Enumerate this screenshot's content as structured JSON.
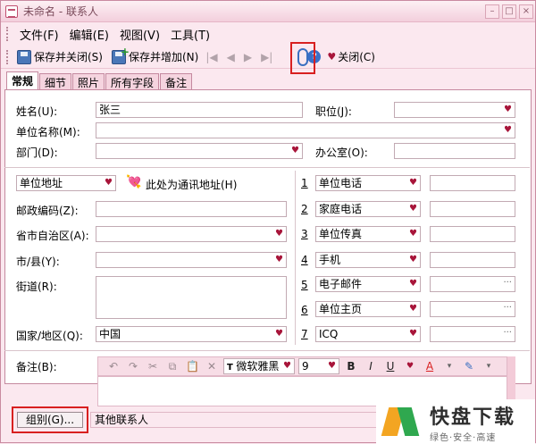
{
  "title": "未命名 - 联系人",
  "menu": [
    "文件(F)",
    "编辑(E)",
    "视图(V)",
    "工具(T)"
  ],
  "toolbar": {
    "save_close": "保存并关闭(S)",
    "save_add": "保存并增加(N)",
    "close": "关闭(C)"
  },
  "tabs": [
    "常规",
    "细节",
    "照片",
    "所有字段",
    "备注"
  ],
  "form": {
    "name_label": "姓名(U):",
    "name_value": "张三",
    "position_label": "职位(J):",
    "company_label": "单位名称(M):",
    "dept_label": "部门(D):",
    "office_label": "办公室(O):",
    "address_type": "单位地址",
    "mailing_label": "此处为通讯地址(H)",
    "postal_label": "邮政编码(Z):",
    "province_label": "省市自治区(A):",
    "city_label": "市/县(Y):",
    "street_label": "街道(R):",
    "country_label": "国家/地区(Q):",
    "country_value": "中国",
    "notes_label": "备注(B):"
  },
  "phones": [
    {
      "num": "1",
      "label": "单位电话"
    },
    {
      "num": "2",
      "label": "家庭电话"
    },
    {
      "num": "3",
      "label": "单位传真"
    },
    {
      "num": "4",
      "label": "手机"
    },
    {
      "num": "5",
      "label": "电子邮件"
    },
    {
      "num": "6",
      "label": "单位主页"
    },
    {
      "num": "7",
      "label": "ICQ"
    }
  ],
  "format": {
    "font": "微软雅黑",
    "size": "9"
  },
  "group": {
    "button": "组别(G)...",
    "value": "其他联系人"
  },
  "watermark": {
    "big": "快盘下载",
    "small": "绿色·安全·高速"
  }
}
